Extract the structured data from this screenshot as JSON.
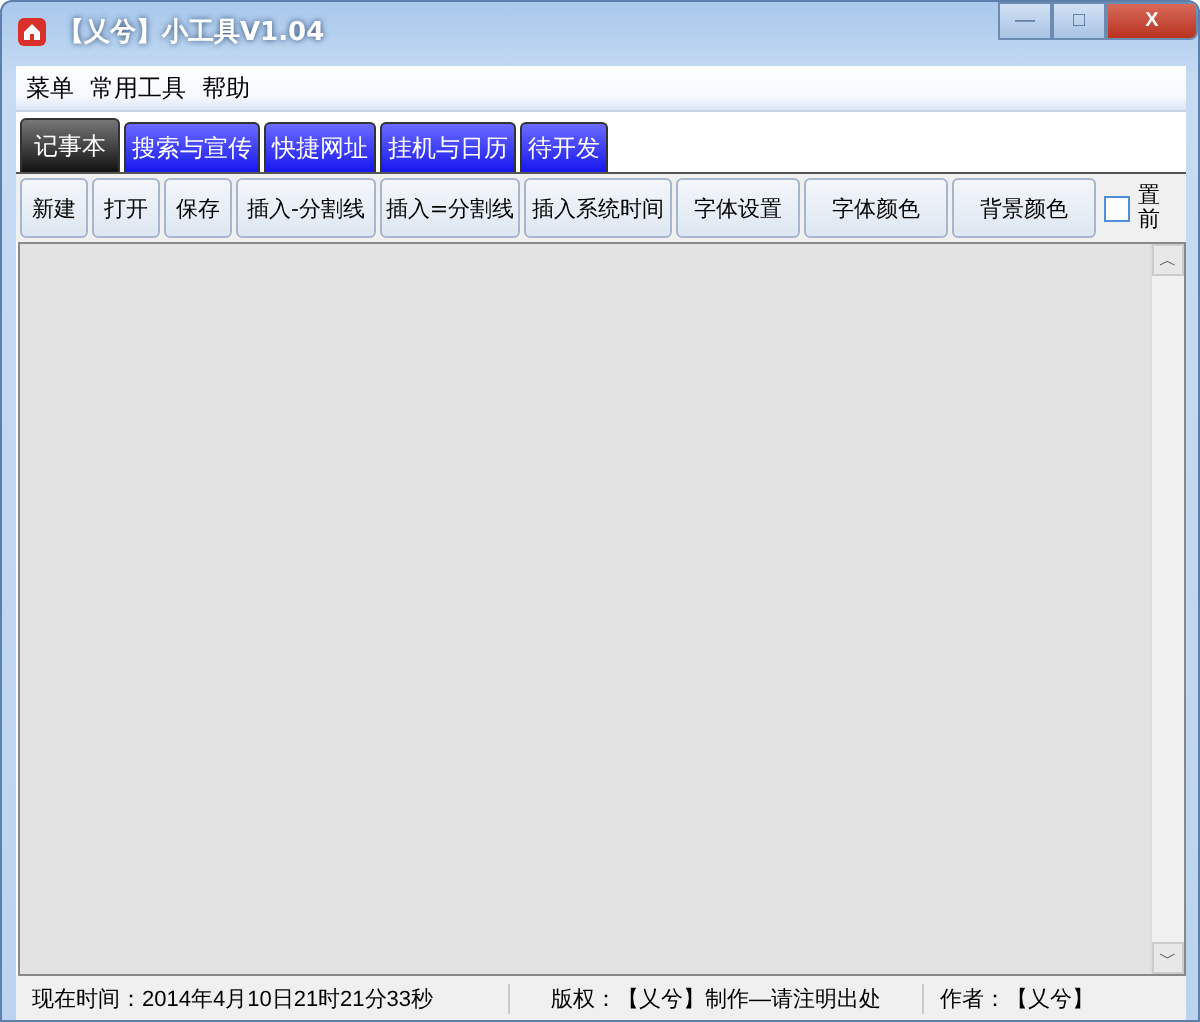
{
  "window": {
    "title": "【乂兮】小工具V1.04",
    "buttons": [
      "—",
      "□",
      "X"
    ]
  },
  "menu": [
    "菜单",
    "常用工具",
    "帮助"
  ],
  "tabs": [
    {
      "label": "记事本",
      "selected": true
    },
    {
      "label": "搜索与宣传",
      "selected": false
    },
    {
      "label": "快捷网址",
      "selected": false
    },
    {
      "label": "挂机与日历",
      "selected": false
    },
    {
      "label": "待开发",
      "selected": false
    }
  ],
  "toolbar": [
    "新建",
    "打开",
    "保存",
    "插入-分割线",
    "插入=分割线",
    "插入系统时间",
    "字体设置",
    "字体颜色",
    "背景颜色"
  ],
  "pin_checkbox": {
    "label": "置前",
    "checked": false
  },
  "scrollbar": {
    "up": "︿",
    "down": "﹀"
  },
  "status_bar": [
    "现在时间：2014年4月10日21时21分33秒",
    "版权：【乂兮】制作—请注明出处",
    "作者：【乂兮】"
  ]
}
